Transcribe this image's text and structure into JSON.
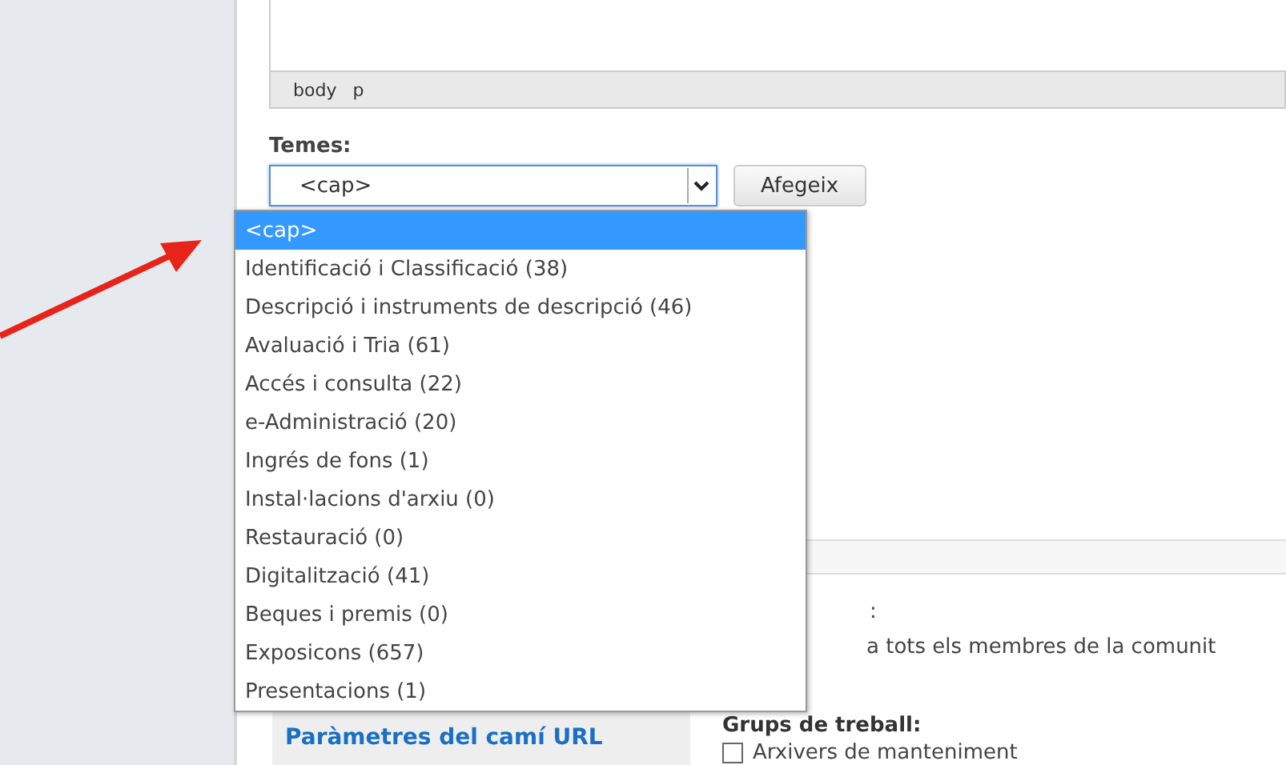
{
  "editor": {
    "path": [
      "body",
      "p"
    ]
  },
  "topics": {
    "label": "Temes:",
    "value": "<cap>",
    "add_button": "Afegeix",
    "expanded": true,
    "options": [
      {
        "label": "<cap>",
        "selected": true
      },
      {
        "label": "Identificació i Classificació (38)",
        "selected": false
      },
      {
        "label": "Descripció i instruments de descripció (46)",
        "selected": false
      },
      {
        "label": "Avaluació i Tria (61)",
        "selected": false
      },
      {
        "label": "Accés i consulta (22)",
        "selected": false
      },
      {
        "label": "e-Administració (20)",
        "selected": false
      },
      {
        "label": "Ingrés de fons (1)",
        "selected": false
      },
      {
        "label": "Instal·lacions d'arxiu (0)",
        "selected": false
      },
      {
        "label": "Restauració (0)",
        "selected": false
      },
      {
        "label": "Digitalització (41)",
        "selected": false
      },
      {
        "label": "Beques i premis (0)",
        "selected": false
      },
      {
        "label": "Exposicons (657)",
        "selected": false
      },
      {
        "label": "Presentacions (1)",
        "selected": false
      }
    ]
  },
  "vertical_tabs": [
    {
      "label": "Paràmetres del camí URL"
    }
  ],
  "access": {
    "heading_tail": ":",
    "line": "a tots els membres de la comunit",
    "groups_heading": "Grups de treball:",
    "groups": [
      {
        "label": "Arxivers de manteniment",
        "checked": false
      }
    ]
  }
}
